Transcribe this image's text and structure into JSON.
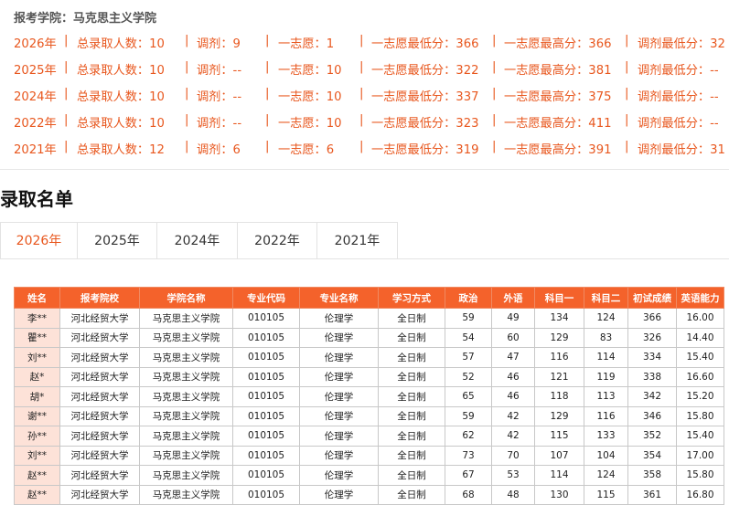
{
  "school_label": "报考学院：马克思主义学院",
  "stats": [
    {
      "year": "2026年",
      "total": "总录取人数：10",
      "adjust": "调剂：9",
      "first": "一志愿：1",
      "first_min": "一志愿最低分：366",
      "first_max": "一志愿最高分：366",
      "adjust_min": "调剂最低分：32"
    },
    {
      "year": "2025年",
      "total": "总录取人数：10",
      "adjust": "调剂：--",
      "first": "一志愿：10",
      "first_min": "一志愿最低分：322",
      "first_max": "一志愿最高分：381",
      "adjust_min": "调剂最低分：--"
    },
    {
      "year": "2024年",
      "total": "总录取人数：10",
      "adjust": "调剂：--",
      "first": "一志愿：10",
      "first_min": "一志愿最低分：337",
      "first_max": "一志愿最高分：375",
      "adjust_min": "调剂最低分：--"
    },
    {
      "year": "2022年",
      "total": "总录取人数：10",
      "adjust": "调剂：--",
      "first": "一志愿：10",
      "first_min": "一志愿最低分：323",
      "first_max": "一志愿最高分：411",
      "adjust_min": "调剂最低分：--"
    },
    {
      "year": "2021年",
      "total": "总录取人数：12",
      "adjust": "调剂：6",
      "first": "一志愿：6",
      "first_min": "一志愿最低分：319",
      "first_max": "一志愿最高分：391",
      "adjust_min": "调剂最低分：31"
    }
  ],
  "separator": "|",
  "section_title": "录取名单",
  "tabs": [
    "2026年",
    "2025年",
    "2024年",
    "2022年",
    "2021年"
  ],
  "active_tab": "2026年",
  "table": {
    "headers": [
      "姓名",
      "报考院校",
      "学院名称",
      "专业代码",
      "专业名称",
      "学习方式",
      "政治",
      "外语",
      "科目一",
      "科目二",
      "初试成绩",
      "英语能力"
    ],
    "rows": [
      [
        "李**",
        "河北经贸大学",
        "马克思主义学院",
        "010105",
        "伦理学",
        "全日制",
        "59",
        "49",
        "134",
        "124",
        "366",
        "16.00"
      ],
      [
        "瞿**",
        "河北经贸大学",
        "马克思主义学院",
        "010105",
        "伦理学",
        "全日制",
        "54",
        "60",
        "129",
        "83",
        "326",
        "14.40"
      ],
      [
        "刘**",
        "河北经贸大学",
        "马克思主义学院",
        "010105",
        "伦理学",
        "全日制",
        "57",
        "47",
        "116",
        "114",
        "334",
        "15.40"
      ],
      [
        "赵*",
        "河北经贸大学",
        "马克思主义学院",
        "010105",
        "伦理学",
        "全日制",
        "52",
        "46",
        "121",
        "119",
        "338",
        "16.60"
      ],
      [
        "胡*",
        "河北经贸大学",
        "马克思主义学院",
        "010105",
        "伦理学",
        "全日制",
        "65",
        "46",
        "118",
        "113",
        "342",
        "15.20"
      ],
      [
        "谢**",
        "河北经贸大学",
        "马克思主义学院",
        "010105",
        "伦理学",
        "全日制",
        "59",
        "42",
        "129",
        "116",
        "346",
        "15.80"
      ],
      [
        "孙**",
        "河北经贸大学",
        "马克思主义学院",
        "010105",
        "伦理学",
        "全日制",
        "62",
        "42",
        "115",
        "133",
        "352",
        "15.40"
      ],
      [
        "刘**",
        "河北经贸大学",
        "马克思主义学院",
        "010105",
        "伦理学",
        "全日制",
        "73",
        "70",
        "107",
        "104",
        "354",
        "17.00"
      ],
      [
        "赵**",
        "河北经贸大学",
        "马克思主义学院",
        "010105",
        "伦理学",
        "全日制",
        "67",
        "53",
        "114",
        "124",
        "358",
        "15.80"
      ],
      [
        "赵**",
        "河北经贸大学",
        "马克思主义学院",
        "010105",
        "伦理学",
        "全日制",
        "68",
        "48",
        "130",
        "115",
        "361",
        "16.80"
      ]
    ]
  },
  "colors": {
    "accent": "#e8571e",
    "header_bg": "#f4622b",
    "name_cell_bg": "#fde2d8"
  }
}
